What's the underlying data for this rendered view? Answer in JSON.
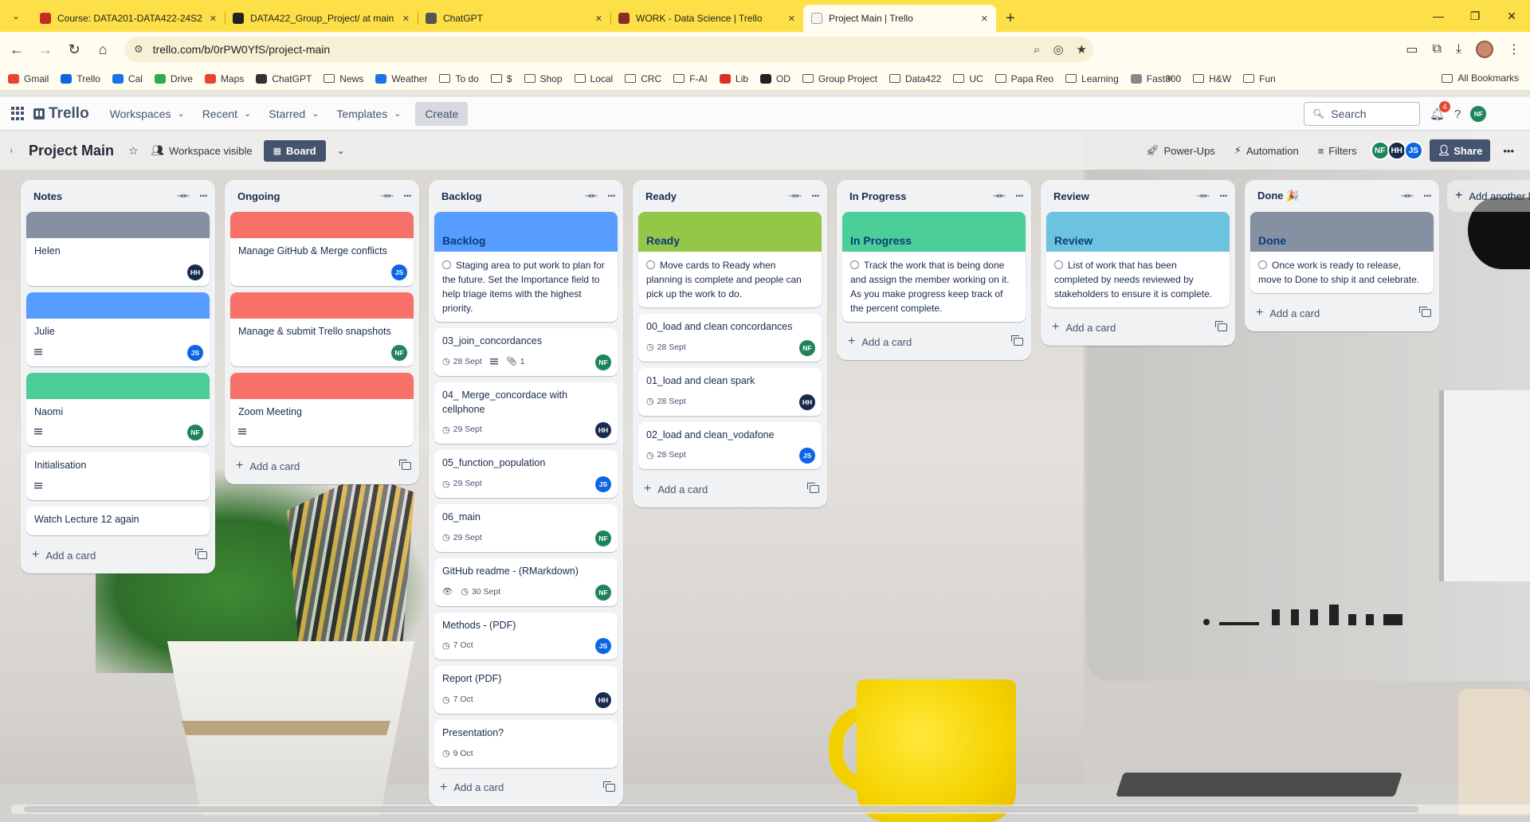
{
  "browser": {
    "tabs": [
      {
        "title": "Course: DATA201-DATA422-24S2",
        "favicon_color": "#c62828",
        "active": false
      },
      {
        "title": "DATA422_Group_Project/ at main",
        "favicon_color": "#222222",
        "active": false
      },
      {
        "title": "ChatGPT",
        "favicon_color": "#555555",
        "active": false
      },
      {
        "title": "WORK - Data Science | Trello",
        "favicon_color": "#8a2a2a",
        "active": false
      },
      {
        "title": "Project Main | Trello",
        "favicon_color": "#f5f5f5",
        "active": true
      }
    ],
    "url": "trello.com/b/0rPW0YfS/project-main",
    "bookmarks": [
      "Gmail",
      "Trello",
      "Cal",
      "Drive",
      "Maps",
      "ChatGPT",
      "News",
      "Weather",
      "To do",
      "$",
      "Shop",
      "Local",
      "CRC",
      "F-AI",
      "Lib",
      "OD",
      "Group Project",
      "Data422",
      "UC",
      "Papa Reo",
      "Learning",
      "Fast800",
      "H&W",
      "Fun"
    ],
    "all_bookmarks": "All Bookmarks"
  },
  "header": {
    "logo": "Trello",
    "nav": [
      "Workspaces",
      "Recent",
      "Starred",
      "Templates"
    ],
    "create": "Create",
    "search_placeholder": "Search",
    "notification_count": "4",
    "user_initials": "NF"
  },
  "board": {
    "title": "Project Main",
    "visibility": "Workspace visible",
    "view": "Board",
    "power_ups": "Power-Ups",
    "automation": "Automation",
    "filters": "Filters",
    "share": "Share",
    "members": [
      {
        "initials": "NF",
        "color": "#1f845a"
      },
      {
        "initials": "HH",
        "color": "#172b4d"
      },
      {
        "initials": "JS",
        "color": "#0c66e4"
      }
    ],
    "add_list": "Add another list",
    "add_card": "Add a card"
  },
  "colors": {
    "NF": "#1f845a",
    "HH": "#172b4d",
    "JS": "#0c66e4",
    "grey": "#8590a2",
    "blue": "#579dff",
    "green": "#4bce97",
    "red": "#f87168",
    "lime": "#94c748",
    "sky": "#6cc3e0"
  },
  "lists": [
    {
      "title": "Notes",
      "cards": [
        {
          "title": "Helen",
          "cover": "grey",
          "member": "HH"
        },
        {
          "title": "Julie",
          "cover": "blue",
          "description": true,
          "member": "JS"
        },
        {
          "title": "Naomi",
          "cover": "green",
          "description": true,
          "member": "NF"
        },
        {
          "title": "Initialisation",
          "description": true
        },
        {
          "title": "Watch Lecture 12 again"
        }
      ]
    },
    {
      "title": "Ongoing",
      "cards": [
        {
          "title": "Manage GitHub & Merge conflicts",
          "cover": "red",
          "member": "JS"
        },
        {
          "title": "Manage & submit Trello snapshots",
          "cover": "red",
          "member": "NF"
        },
        {
          "title": "Zoom Meeting",
          "cover": "red",
          "description": true
        }
      ]
    },
    {
      "title": "Backlog",
      "cards": [
        {
          "banner": "Backlog",
          "cover": "blue",
          "desc": "Staging area to put work to plan for the future. Set the Importance field to help triage items with the highest priority."
        },
        {
          "title": "03_join_concordances",
          "date": "28 Sept",
          "description": true,
          "attachments": "1",
          "member": "NF"
        },
        {
          "title": "04_ Merge_concordace with cellphone",
          "date": "29 Sept",
          "member": "HH"
        },
        {
          "title": "05_function_population",
          "date": "29 Sept",
          "member": "JS"
        },
        {
          "title": "06_main",
          "date": "29 Sept",
          "member": "NF"
        },
        {
          "title": "GitHub readme - (RMarkdown)",
          "date": "30 Sept",
          "watch": true,
          "member": "NF"
        },
        {
          "title": "Methods - (PDF)",
          "date": "7 Oct",
          "member": "JS"
        },
        {
          "title": "Report (PDF)",
          "date": "7 Oct",
          "member": "HH"
        },
        {
          "title": "Presentation?",
          "date": "9 Oct"
        }
      ]
    },
    {
      "title": "Ready",
      "cards": [
        {
          "banner": "Ready",
          "cover": "lime",
          "desc": "Move cards to Ready when planning is complete and people can pick up the work to do."
        },
        {
          "title": "00_load and clean concordances",
          "date": "28 Sept",
          "member": "NF"
        },
        {
          "title": "01_load and clean spark",
          "date": "28 Sept",
          "member": "HH"
        },
        {
          "title": "02_load and clean_vodafone",
          "date": "28 Sept",
          "member": "JS"
        }
      ]
    },
    {
      "title": "In Progress",
      "cards": [
        {
          "banner": "In Progress",
          "cover": "green",
          "desc": "Track the work that is being done and assign the member working on it. As you make progress keep track of the percent complete."
        }
      ]
    },
    {
      "title": "Review",
      "cards": [
        {
          "banner": "Review",
          "cover": "sky",
          "desc": "List of work that has been completed by needs reviewed by stakeholders to ensure it is complete."
        }
      ]
    },
    {
      "title": "Done 🎉",
      "cards": [
        {
          "banner": "Done",
          "cover": "grey",
          "desc": "Once work is ready to release, move to Done to ship it and celebrate."
        }
      ]
    }
  ]
}
